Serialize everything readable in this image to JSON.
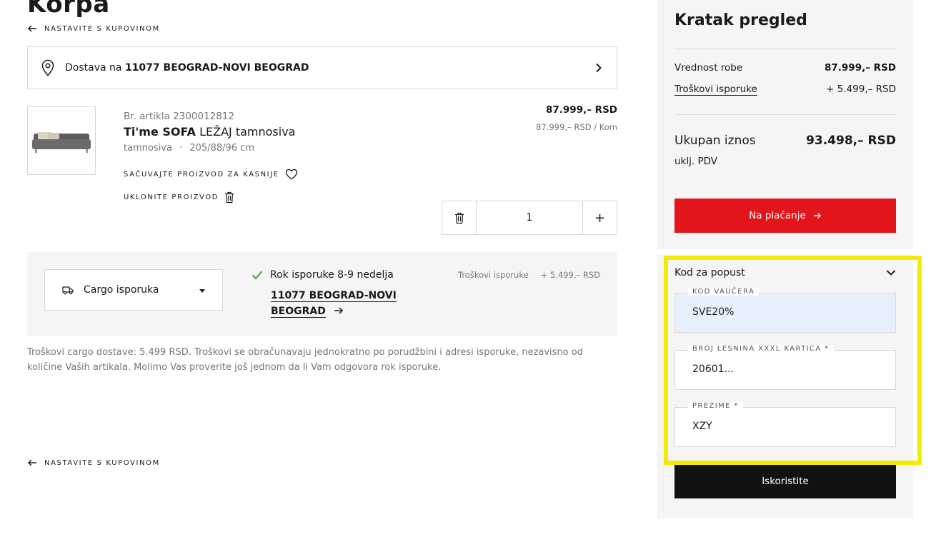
{
  "page": {
    "title": "Korpa"
  },
  "nav": {
    "back_label": "NASTAVITE S KUPOVINOM"
  },
  "delivery": {
    "prefix": "Dostava na",
    "location": "11077 BEOGRAD-NOVI BEOGRAD"
  },
  "product": {
    "article_label": "Br. artikla 2300012812",
    "name_bold": "Ti'me SOFA",
    "name_rest": "LEŽAJ tamnosiva",
    "color": "tamnosiva",
    "separator": "·",
    "dimensions": "205/88/96 cm",
    "save_label": "SAČUVAJTE PROIZVOD ZA KASNIJE",
    "remove_label": "UKLONITE PROIZVOD",
    "price": "87.999,– RSD",
    "unit_price": "87.999,– RSD / Kom",
    "quantity": "1",
    "plus": "+"
  },
  "shipping": {
    "method": "Cargo isporuka",
    "eta": "Rok isporuke 8-9 nedelja",
    "addr_line1": "11077 BEOGRAD-NOVI",
    "addr_line2": "BEOGRAD",
    "cost_label": "Troškovi isporuke",
    "cost_value": "+ 5.499,– RSD",
    "note": "Troškovi cargo dostave: 5.499 RSD. Troškovi se obračunavaju jednokratno po porudžbini i adresi isporuke, nezavisno od količine Vaših artikala. Molimo Vas proverite još jednom da li Vam odgovora rok isporuke."
  },
  "summary": {
    "title": "Kratak pregled",
    "goods_label": "Vrednost robe",
    "goods_value": "87.999,– RSD",
    "delivery_label": "Troškovi isporuke",
    "delivery_value": "+ 5.499,– RSD",
    "total_label": "Ukupan iznos",
    "total_value": "93.498,– RSD",
    "vat": "uklj. PDV",
    "checkout_label": "Na plaćanje"
  },
  "discount": {
    "title": "Kod za popust",
    "voucher_label": "KOD VAUČERA",
    "voucher_value": "SVE20%",
    "card_label": "BROJ LESNINA XXXL KARTICA *",
    "card_value": "20601...",
    "surname_label": "PREZIME *",
    "surname_value": "XZY",
    "apply_label": "Iskoristite"
  },
  "colors": {
    "accent_red": "#e3151a",
    "highlight": "#f4ec00",
    "check_green": "#3aa935"
  }
}
